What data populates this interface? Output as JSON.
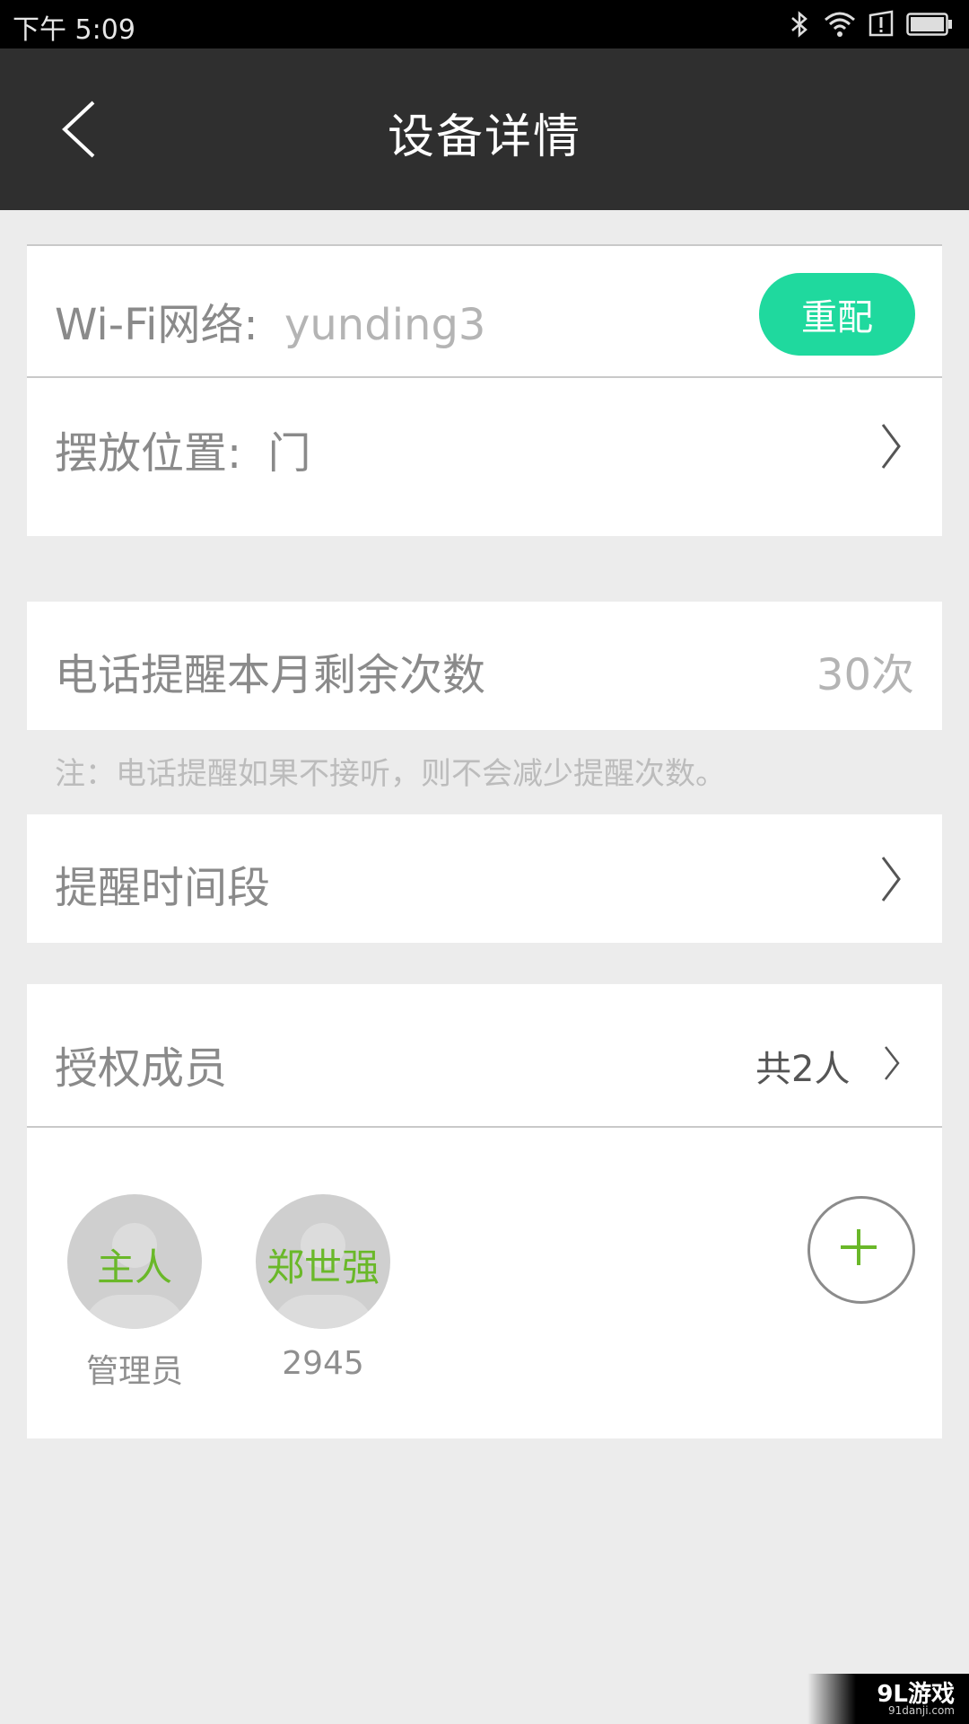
{
  "status_bar": {
    "time": "下午 5:09"
  },
  "header": {
    "title": "设备详情"
  },
  "wifi": {
    "label": "Wi-Fi网络:",
    "value": "yunding3",
    "reconfig_button": "重配"
  },
  "location": {
    "label": "摆放位置:",
    "value": "门"
  },
  "phone_reminder": {
    "label": "电话提醒本月剩余次数",
    "count": "30次",
    "note": "注：电话提醒如果不接听，则不会减少提醒次数。"
  },
  "reminder_period": {
    "label": "提醒时间段"
  },
  "members": {
    "label": "授权成员",
    "total": "共2人",
    "list": [
      {
        "name": "主人",
        "sub": "管理员"
      },
      {
        "name": "郑世强",
        "sub": "2945"
      }
    ]
  },
  "watermark": {
    "brand": "9L游戏",
    "url": "91danji.com"
  },
  "colors": {
    "accent": "#1fd99e",
    "member_name": "#6ab829",
    "appbar": "#2f2f2f",
    "add_plus": "#6ab829"
  }
}
